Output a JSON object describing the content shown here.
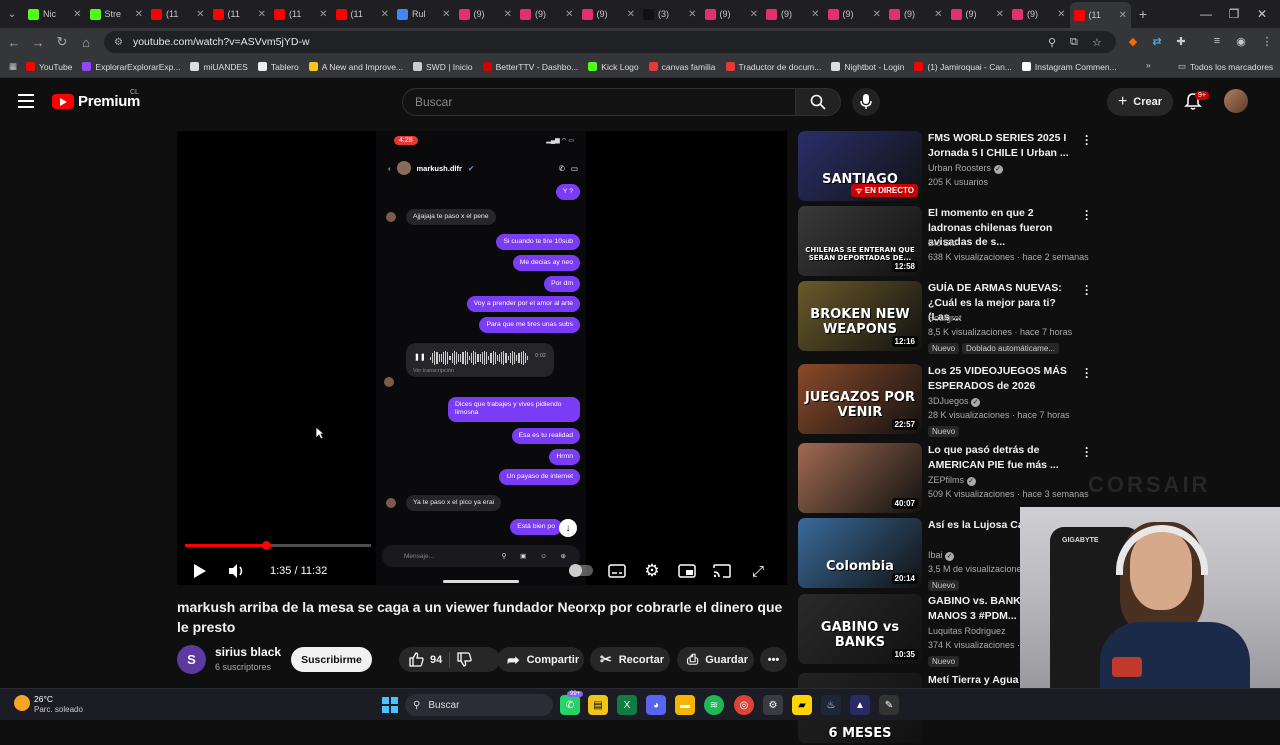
{
  "browser": {
    "tabs": [
      {
        "label": "Nic",
        "icon": "kick-icon",
        "color": "#53fc18"
      },
      {
        "label": "Stre",
        "icon": "kick-icon",
        "color": "#53fc18"
      },
      {
        "label": "(11",
        "icon": "youtube-icon",
        "color": "#ff0000"
      },
      {
        "label": "(11",
        "icon": "youtube-icon",
        "color": "#ff0000"
      },
      {
        "label": "(11",
        "icon": "youtube-icon",
        "color": "#ff0000"
      },
      {
        "label": "(11",
        "icon": "youtube-icon",
        "color": "#ff0000"
      },
      {
        "label": "Rul",
        "icon": "grid-icon",
        "color": "#4285f4"
      },
      {
        "label": "(9)",
        "icon": "instagram-icon",
        "color": "#e1306c"
      },
      {
        "label": "(9)",
        "icon": "instagram-icon",
        "color": "#e1306c"
      },
      {
        "label": "(9)",
        "icon": "instagram-icon",
        "color": "#e1306c"
      },
      {
        "label": "(3)",
        "icon": "tiktok-icon",
        "color": "#111111"
      },
      {
        "label": "(9)",
        "icon": "instagram-icon",
        "color": "#e1306c"
      },
      {
        "label": "(9)",
        "icon": "instagram-icon",
        "color": "#e1306c"
      },
      {
        "label": "(9)",
        "icon": "instagram-icon",
        "color": "#e1306c"
      },
      {
        "label": "(9)",
        "icon": "instagram-icon",
        "color": "#e1306c"
      },
      {
        "label": "(9)",
        "icon": "instagram-icon",
        "color": "#e1306c"
      },
      {
        "label": "(9)",
        "icon": "instagram-icon",
        "color": "#e1306c"
      },
      {
        "label": "(11",
        "icon": "youtube-icon",
        "color": "#ff0000",
        "active": true
      }
    ],
    "url": "youtube.com/watch?v=ASVvm5jYD-w",
    "bookmarks": [
      {
        "label": "YouTube",
        "color": "#ff0000"
      },
      {
        "label": "ExplorarExplorarExp...",
        "color": "#9146ff"
      },
      {
        "label": "miUANDES",
        "color": "#dddddd"
      },
      {
        "label": "Tablero",
        "color": "#eeeeee"
      },
      {
        "label": "A New and Improve...",
        "color": "#f5c518"
      },
      {
        "label": "SWD | Inicio",
        "color": "#cccccc"
      },
      {
        "label": "BetterTTV - Dashbo...",
        "color": "#d50000"
      },
      {
        "label": "Kick Logo",
        "color": "#53fc18"
      },
      {
        "label": "canvas familia",
        "color": "#e53935"
      },
      {
        "label": "Traductor de docum...",
        "color": "#e53935"
      },
      {
        "label": "Nightbot - Login",
        "color": "#dddddd"
      },
      {
        "label": "(1) Jamiroquai - Can...",
        "color": "#ff0000"
      },
      {
        "label": "Instagram Commen...",
        "color": "#ffffff"
      }
    ],
    "all_bookmarks_label": "Todos los marcadores"
  },
  "youtube": {
    "logo_text": "Premium",
    "country": "CL",
    "search_placeholder": "Buscar",
    "create_label": "Crear",
    "notifications": "9+"
  },
  "video": {
    "progress": 0.436,
    "time_current": "1:35",
    "time_total": "11:32",
    "time_display": "1:35 / 11:32",
    "title": "markush arriba de la mesa se caga a un viewer fundador Neorxp por cobrarle el dinero que le presto",
    "channel": "sirius black",
    "channel_initial": "S",
    "subscribers": "6 suscriptores",
    "subscribe_label": "Suscribirme",
    "likes": "94",
    "share_label": "Compartir",
    "clip_label": "Recortar",
    "save_label": "Guardar"
  },
  "phone": {
    "time": "4:28",
    "contact": "markush.dlfr",
    "voice_duration": "0:02",
    "voice_caption": "Ver transcripción",
    "input_placeholder": "Mensaje...",
    "messages": [
      {
        "dir": "out",
        "text": "Y ?"
      },
      {
        "dir": "in",
        "text": "Ajjajaja te paso x el pene"
      },
      {
        "dir": "out",
        "text": "Si cuando te tire 10sub"
      },
      {
        "dir": "out",
        "text": "Me decias ay neo"
      },
      {
        "dir": "out",
        "text": "Por dm"
      },
      {
        "dir": "out",
        "text": "Voy a prender por el amor al arte"
      },
      {
        "dir": "out",
        "text": "Para que me tires unas subs"
      },
      {
        "dir": "out",
        "text": "Dices que trabajes y vives pidiendo limosna"
      },
      {
        "dir": "out",
        "text": "Esa es tu realidad"
      },
      {
        "dir": "out",
        "text": "Hrmn"
      },
      {
        "dir": "out",
        "text": "Un payaso de internet"
      },
      {
        "dir": "in",
        "text": "Ya te paso x el pico ya erai"
      },
      {
        "dir": "out",
        "text": "Está bien po"
      }
    ]
  },
  "suggestions": [
    {
      "title": "FMS WORLD SERIES 2025 I Jornada 5 I CHILE I Urban ...",
      "channel": "Urban Roosters",
      "verified": true,
      "meta": "205 K usuarios",
      "live": "EN DIRECTO",
      "thumb_text": "SANTIAGO",
      "thumb_color": "#2a2f6a"
    },
    {
      "title": "El momento en que 2 ladronas chilenas fueron avisadas de s...",
      "channel": "Bio Bio",
      "verified": false,
      "meta": "638 K visualizaciones · hace 2 semanas",
      "duration": "12:58",
      "thumb_text": "CHILENAS SE ENTERAN QUE SERÁN DEPORTADAS DE...",
      "thumb_color": "#3a3a3a"
    },
    {
      "title": "GUÍA DE ARMAS NUEVAS: ¿Cuál es la mejor para ti? (Las ...",
      "channel": "Soulgrot",
      "verified": false,
      "meta": "8,5 K visualizaciones · hace 7 horas",
      "duration": "12:16",
      "badge": "Nuevo",
      "badge2": "Doblado automáticame...",
      "thumb_text": "BROKEN NEW WEAPONS",
      "thumb_color": "#6a5a2a"
    },
    {
      "title": "Los 25 VIDEOJUEGOS MÁS ESPERADOS de 2026",
      "channel": "3DJuegos",
      "verified": true,
      "meta": "28 K visualizaciones · hace 7 horas",
      "duration": "22:57",
      "badge": "Nuevo",
      "thumb_text": "JUEGAZOS POR VENIR",
      "thumb_color": "#8a4a2a"
    },
    {
      "title": "Lo que pasó detrás de AMERICAN PIE fue más ...",
      "channel": "ZEPfilms",
      "verified": true,
      "meta": "509 K visualizaciones · hace 3 semanas",
      "duration": "40:07",
      "thumb_text": "",
      "thumb_color": "#a06a50"
    },
    {
      "title": "Así es la Lujosa Cas...",
      "channel": "Ibai",
      "verified": true,
      "meta": "3,5 M de visualizacione...",
      "duration": "20:14",
      "badge": "Nuevo",
      "thumb_text": "Colombia",
      "thumb_color": "#3a6a9a"
    },
    {
      "title": "GABINO vs. BANKS DE MANOS 3 #PDM...",
      "channel": "Luquitas Rodriguez",
      "verified": false,
      "meta": "374 K visualizaciones · ha...",
      "duration": "10:35",
      "badge": "Nuevo",
      "thumb_text": "GABINO vs BANKS",
      "thumb_color": "#2a2a2a"
    },
    {
      "title": "Metí Tierra y Agua e...",
      "channel": "",
      "verified": false,
      "meta": "",
      "thumb_text": "6 MESES",
      "thumb_color": "#222222"
    }
  ],
  "overlay": {
    "brand": "CORSAIR",
    "chair_brand": "GIGABYTE"
  },
  "taskbar": {
    "temp": "26°C",
    "weather": "Parc. soleado",
    "search": "Buscar",
    "badge": "99+"
  }
}
